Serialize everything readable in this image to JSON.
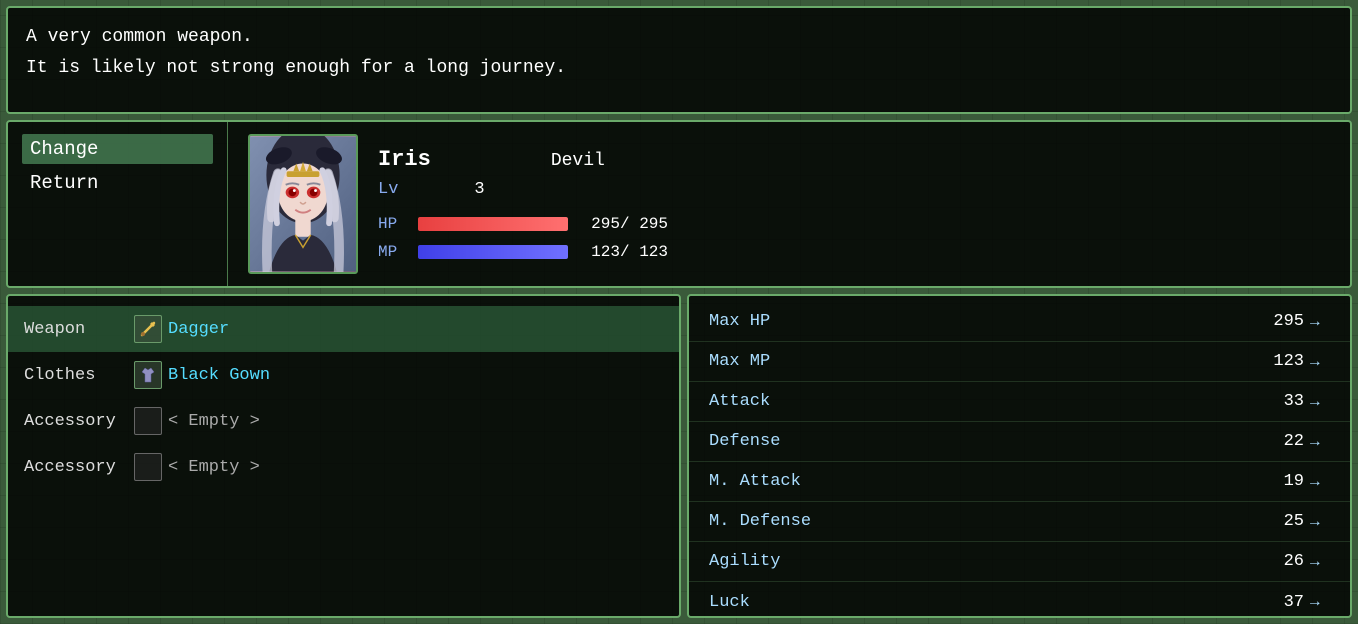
{
  "description": {
    "line1": "A very common weapon.",
    "line2": "It is likely not strong enough for a long journey."
  },
  "menu": {
    "options": [
      {
        "label": "Change",
        "selected": true
      },
      {
        "label": "Return",
        "selected": false
      }
    ]
  },
  "character": {
    "name": "Iris",
    "class": "Devil",
    "level_label": "Lv",
    "level": "3",
    "hp_label": "HP",
    "hp_current": "295",
    "hp_max": "295",
    "mp_label": "MP",
    "mp_current": "123",
    "mp_max": "123"
  },
  "equipment": {
    "slots": [
      {
        "label": "Weapon",
        "icon": "🗡",
        "name": "Dagger",
        "type": "has-item",
        "active": true
      },
      {
        "label": "Clothes",
        "icon": "👘",
        "name": "Black Gown",
        "type": "has-item",
        "active": false
      },
      {
        "label": "Accessory",
        "icon": "",
        "name": "< Empty >",
        "type": "empty",
        "active": false
      },
      {
        "label": "Accessory",
        "icon": "",
        "name": "< Empty >",
        "type": "empty",
        "active": false
      }
    ]
  },
  "stats": [
    {
      "name": "Max HP",
      "value": "295",
      "arrow": "→"
    },
    {
      "name": "Max MP",
      "value": "123",
      "arrow": "→"
    },
    {
      "name": "Attack",
      "value": "33",
      "arrow": "→"
    },
    {
      "name": "Defense",
      "value": "22",
      "arrow": "→"
    },
    {
      "name": "M. Attack",
      "value": "19",
      "arrow": "→"
    },
    {
      "name": "M. Defense",
      "value": "25",
      "arrow": "→"
    },
    {
      "name": "Agility",
      "value": "26",
      "arrow": "→"
    },
    {
      "name": "Luck",
      "value": "37",
      "arrow": "→"
    }
  ]
}
